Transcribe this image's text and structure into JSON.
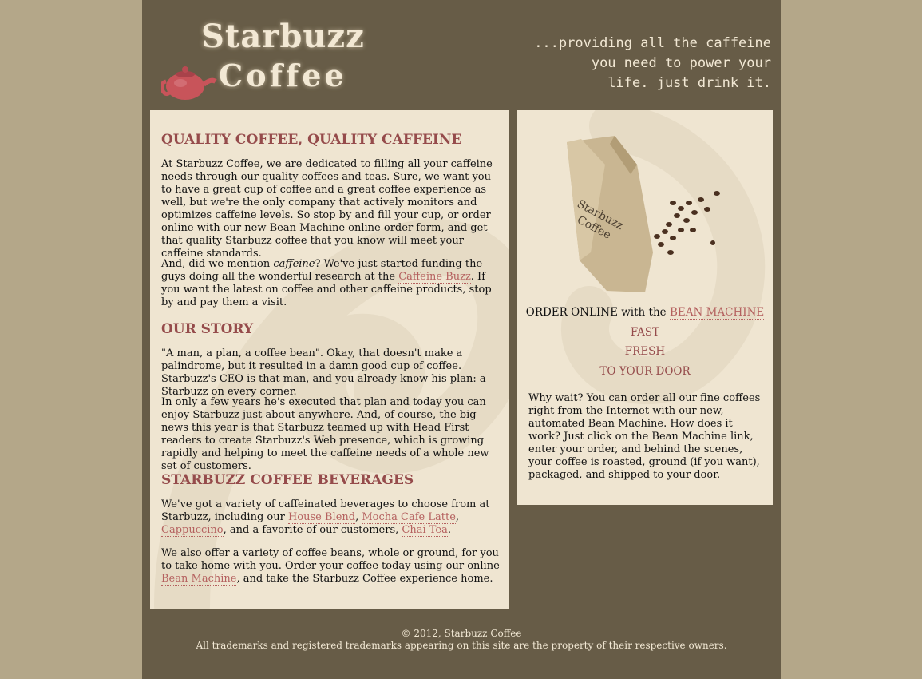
{
  "header": {
    "logo_top": "Starbuzz",
    "logo_bottom": "Coffee",
    "slogan_lines": [
      "...providing all the caffeine",
      "you need to power your",
      "life. just drink it."
    ]
  },
  "main": {
    "sections": [
      {
        "heading": "QUALITY COFFEE, QUALITY CAFFEINE",
        "p1": "At Starbuzz Coffee, we are dedicated to filling all your caffeine needs through our quality coffees and teas. Sure, we want you to have a great cup of coffee and a great coffee experience as well, but we're the only company that actively monitors and optimizes caffeine levels. So stop by and fill your cup, or order online with our new Bean Machine online order form, and get that quality Starbuzz coffee that you know will meet your caffeine standards.",
        "p2_a": "And, did we mention ",
        "p2_em": "caffeine",
        "p2_b": "? We've just started funding the guys doing all the wonderful research at the ",
        "p2_link": "Caffeine Buzz",
        "p2_c": ". If you want the latest on coffee and other caffeine products, stop by and pay them a visit."
      },
      {
        "heading": "OUR STORY",
        "p1": "\"A man, a plan, a coffee bean\". Okay, that doesn't make a palindrome, but it resulted in a damn good cup of coffee. Starbuzz's CEO is that man, and you already know his plan: a Starbuzz on every corner.",
        "p2": "In only a few years he's executed that plan and today you can enjoy Starbuzz just about anywhere. And, of course, the big news this year is that Starbuzz teamed up with Head First readers to create Starbuzz's Web presence, which is growing rapidly and helping to meet the caffeine needs of a whole new set of customers."
      },
      {
        "heading": "STARBUZZ COFFEE BEVERAGES",
        "p1_a": "We've got a variety of caffeinated beverages to choose from at Starbuzz, including our ",
        "links": [
          "House Blend",
          "Mocha Cafe Latte",
          "Cappuccino",
          "Chai Tea"
        ],
        "sep1": ", ",
        "sep2": ", ",
        "sep3": ", and a favorite of our customers, ",
        "p1_end": ".",
        "p2_a": "We also offer a variety of coffee beans, whole or ground, for you to take home with you. Order your coffee today using our online ",
        "p2_link": "Bean Machine",
        "p2_b": ", and take the Starbuzz Coffee experience home."
      }
    ]
  },
  "sidebar": {
    "bag_text_top": "Starbuzz",
    "bag_text_bottom": "Coffee",
    "order_prefix": "ORDER ONLINE with the ",
    "order_link": "BEAN MACHINE",
    "lines": [
      "FAST",
      "FRESH",
      "TO YOUR DOOR"
    ],
    "paragraph": "Why wait? You can order all our fine coffees right from the Internet with our new, automated Bean Machine. How does it work? Just click on the Bean Machine link, enter your order, and behind the scenes, your coffee is roasted, ground (if you want), packaged, and shipped to your door."
  },
  "footer": {
    "copyright": "© 2012, Starbuzz Coffee",
    "trademark": "All trademarks and registered trademarks appearing on this site are the property of their respective owners."
  },
  "colors": {
    "page_bg": "#b4a789",
    "content_bg": "#675c47",
    "panel_bg": "#efe5d1",
    "heading": "#954b4b",
    "link": "#b5615f",
    "light_text": "#f2e8d4"
  }
}
